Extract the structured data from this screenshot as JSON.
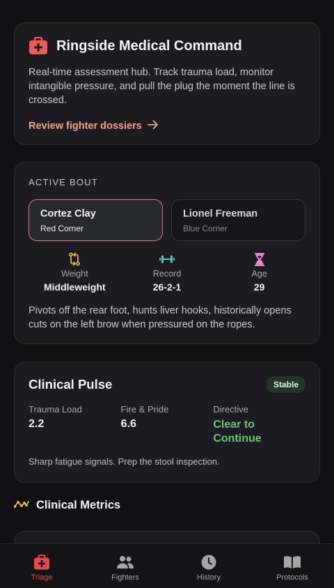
{
  "hero": {
    "title": "Ringside Medical Command",
    "description": "Real-time assessment hub. Track trauma load, monitor intangible pressure, and pull the plug the moment the line is crossed.",
    "link_label": "Review fighter dossiers",
    "icon": "medkit-icon",
    "accent": "#ef5b5b"
  },
  "bout": {
    "section_label": "ACTIVE BOUT",
    "red": {
      "name": "Cortez Clay",
      "corner": "Red Corner"
    },
    "blue": {
      "name": "Lionel Freeman",
      "corner": "Blue Corner"
    },
    "stats": [
      {
        "icon": "weight-transfer-icon",
        "label": "Weight",
        "value": "Middleweight"
      },
      {
        "icon": "dumbbell-icon",
        "label": "Record",
        "value": "26-2-1"
      },
      {
        "icon": "hourglass-icon",
        "label": "Age",
        "value": "29"
      }
    ],
    "notes": "Pivots off the rear foot, hunts liver hooks, historically opens cuts on the left brow when pressured on the ropes."
  },
  "pulse": {
    "title": "Clinical Pulse",
    "badge": "Stable",
    "columns": [
      {
        "label": "Trauma Load",
        "value": "2.2"
      },
      {
        "label": "Fire & Pride",
        "value": "6.6"
      },
      {
        "label": "Directive",
        "value": "Clear to Continue"
      }
    ],
    "note": "Sharp fatigue signals. Prep the stool inspection."
  },
  "metrics": {
    "title": "Clinical Metrics"
  },
  "nav": {
    "items": [
      {
        "label": "Triage",
        "icon": "medkit-icon",
        "active": true
      },
      {
        "label": "Fighters",
        "icon": "users-icon",
        "active": false
      },
      {
        "label": "History",
        "icon": "clock-icon",
        "active": false
      },
      {
        "label": "Protocols",
        "icon": "book-icon",
        "active": false
      }
    ]
  },
  "colors": {
    "background": "#111113",
    "card": "#1b1b21",
    "accent_red": "#e5484d",
    "link": "#f2a584",
    "green": "#6fc77a",
    "gold": "#e8b04a",
    "teal": "#5ec4b6",
    "pink": "#e58bd0"
  }
}
